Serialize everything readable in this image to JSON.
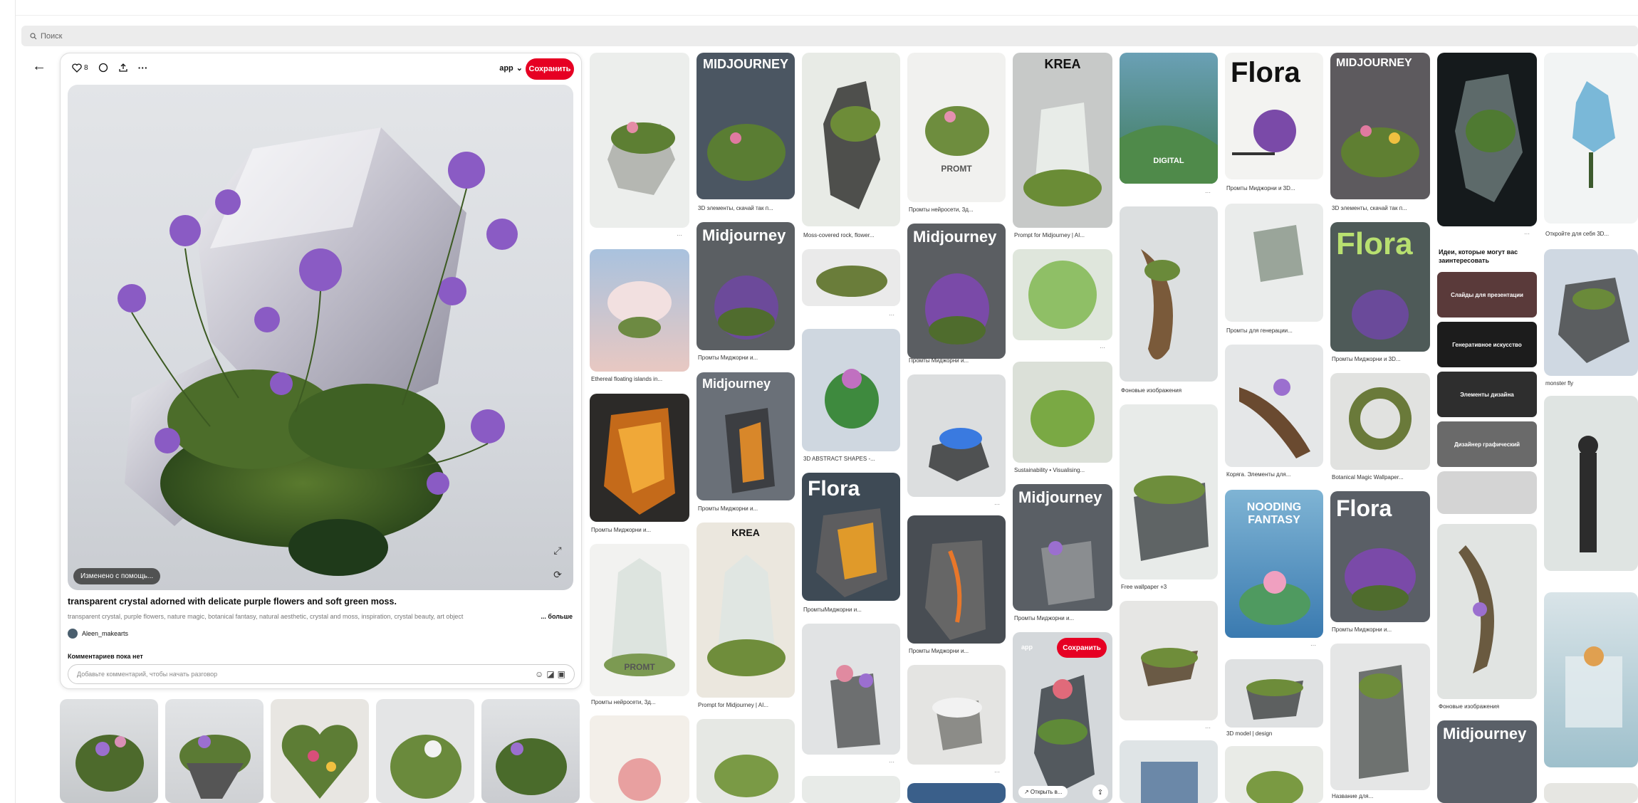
{
  "search": {
    "placeholder": "Поиск"
  },
  "pin": {
    "likes": "8",
    "board": "app",
    "save_label": "Сохранить",
    "edited_label": "Изменено с помощь...",
    "title": "transparent crystal adorned with delicate purple flowers and soft green moss.",
    "description": "transparent crystal, purple flowers, nature magic, botanical fantasy, natural aesthetic, crystal and moss, inspiration, crystal beauty, art object",
    "more_label": "... больше",
    "author": "Aleen_makearts",
    "comments_label": "Комментариев пока нет",
    "comment_placeholder": "Добавьте комментарий, чтобы начать разговор"
  },
  "grid": [
    {
      "caption": "",
      "overlay": ""
    },
    {
      "caption": "3D элементы, скачай так п...",
      "overlay": "MIDJOURNEY"
    },
    {
      "caption": "Moss-covered rock, flower...",
      "overlay": ""
    },
    {
      "caption": "Промты нейросети, 3д...",
      "overlay": "PROMT"
    },
    {
      "caption": "Prompt for Midjourney | AI...",
      "overlay": "KREA"
    },
    {
      "caption": "",
      "overlay": "DIGITAL"
    },
    {
      "caption": "Промты Миджорни и 3D...",
      "overlay": "Flora"
    },
    {
      "caption": "3D элементы, скачай так п...",
      "overlay": "MIDJOURNEY"
    },
    {
      "caption": "",
      "overlay": ""
    },
    {
      "caption": "Откройте для себя 3D...",
      "overlay": ""
    },
    {
      "caption": "Ethereal floating islands in...",
      "overlay": ""
    },
    {
      "caption": "Промты Миджорни и...",
      "overlay": "Midjourney"
    },
    {
      "caption": "",
      "overlay": ""
    },
    {
      "caption": "Промты Миджорни и...",
      "overlay": "Midjourney"
    },
    {
      "caption": "",
      "overlay": ""
    },
    {
      "caption": "Фоновые изображения",
      "overlay": ""
    },
    {
      "caption": "Промты для генерации...",
      "overlay": ""
    },
    {
      "caption": "Промты Миджорни и 3D...",
      "overlay": "Flora"
    },
    {
      "caption": "monster fly",
      "overlay": ""
    },
    {
      "caption": "Промты Миджорни и...",
      "overlay": "Midjourney"
    },
    {
      "caption": "Промты Миджорни и...",
      "overlay": "Midjourney"
    },
    {
      "caption": "3D ABSTRACT SHAPES -...",
      "overlay": ""
    },
    {
      "caption": "",
      "overlay": ""
    },
    {
      "caption": "Sustainability • Visualising...",
      "overlay": ""
    },
    {
      "caption": "Коряга. Элементы для...",
      "overlay": ""
    },
    {
      "caption": "Botanical Magic Wallpaper...",
      "overlay": ""
    },
    {
      "caption": "ПромтыМиджорни и...",
      "overlay": "Flora"
    },
    {
      "caption": "Промты Миджорни и...",
      "overlay": ""
    },
    {
      "caption": "Промты Миджорни и...",
      "overlay": "Midjourney"
    },
    {
      "caption": "Free wallpaper +3",
      "overlay": ""
    },
    {
      "caption": "",
      "overlay": "NOODING FANTASY"
    },
    {
      "caption": "Промты Миджорни и...",
      "overlay": "Flora"
    },
    {
      "caption": "Промты нейросети, 3д...",
      "overlay": "PROMT"
    },
    {
      "caption": "Prompt for Midjourney | AI...",
      "overlay": "KREA"
    },
    {
      "caption": "Фоновые изображения",
      "overlay": ""
    },
    {
      "caption": "3D model | design",
      "overlay": ""
    },
    {
      "caption": "Название для...",
      "overlay": ""
    }
  ],
  "ideas": {
    "title": "Идеи, которые могут вас заинтересовать",
    "items": [
      "Слайды для презентации",
      "Генеративное искусство",
      "Элементы дизайна",
      "Дизайнер графический"
    ]
  },
  "hover_pin": {
    "board": "app",
    "save_label": "Сохранить",
    "open_label": "↗ Открыть в..."
  }
}
